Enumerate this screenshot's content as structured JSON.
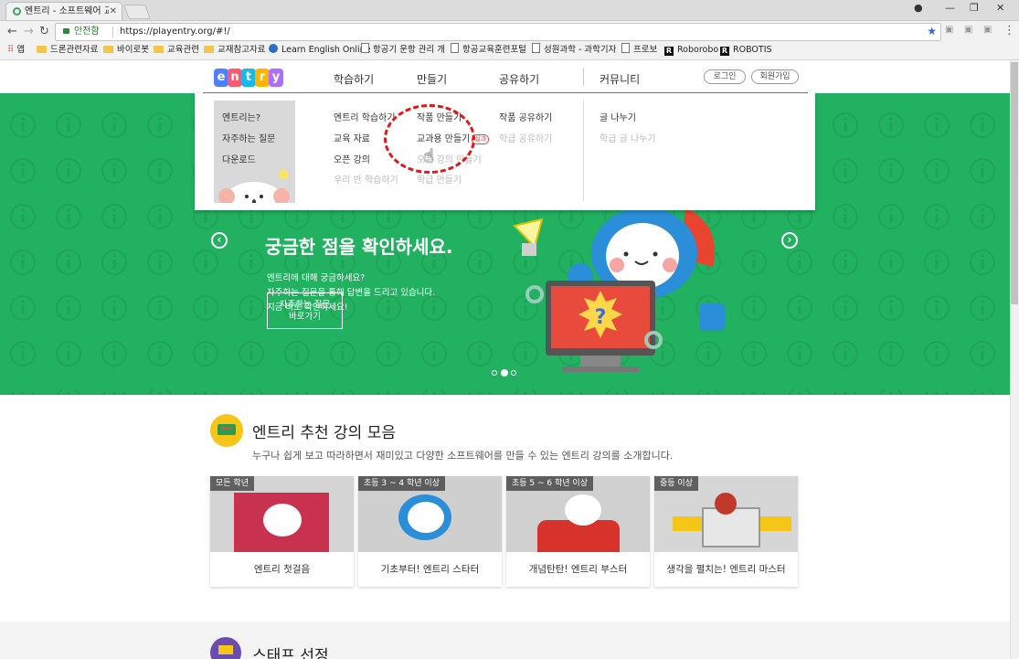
{
  "browser": {
    "tab_title": "엔트리 - 소프트웨어 교육",
    "secure_label": "안전함",
    "url": "https://playentry.org/#!/",
    "bookmarks": [
      {
        "label": "앱",
        "kind": "apps"
      },
      {
        "label": "드론관련자료",
        "kind": "folder"
      },
      {
        "label": "바이로봇",
        "kind": "folder"
      },
      {
        "label": "교육관련",
        "kind": "folder"
      },
      {
        "label": "교재참고자료",
        "kind": "folder"
      },
      {
        "label": "Learn English Online",
        "kind": "globe"
      },
      {
        "label": "항공기 운항 관리 개론",
        "kind": "doc"
      },
      {
        "label": "항공교육훈련포털",
        "kind": "doc"
      },
      {
        "label": "성원과학 - 과학기자재",
        "kind": "doc"
      },
      {
        "label": "프로보",
        "kind": "doc"
      },
      {
        "label": "Roborobo",
        "kind": "r"
      },
      {
        "label": "ROBOTIS",
        "kind": "r"
      }
    ]
  },
  "header": {
    "logo_letters": [
      "e",
      "n",
      "t",
      "r",
      "y"
    ],
    "logo_colors": [
      "#4f80ff",
      "#ff596f",
      "#19baea",
      "#ffb500",
      "#ae6eff"
    ],
    "nav": [
      "학습하기",
      "만들기",
      "공유하기",
      "커뮤니티"
    ],
    "login": "로그인",
    "signup": "회원가입"
  },
  "mega_menu": {
    "side": [
      "엔트리는?",
      "자주하는 질문",
      "다운로드"
    ],
    "learn": [
      {
        "label": "엔트리 학습하기",
        "disabled": false
      },
      {
        "label": "교육 자료",
        "disabled": false
      },
      {
        "label": "오픈 강의",
        "disabled": false
      },
      {
        "label": "우리 반 학습하기",
        "disabled": true
      }
    ],
    "make": [
      {
        "label": "작품 만들기",
        "disabled": false
      },
      {
        "label": "교과용 만들기",
        "disabled": false,
        "badge": "실과"
      },
      {
        "label": "오픈 강의 만들기",
        "disabled": true
      },
      {
        "label": "학급 만들기",
        "disabled": true
      }
    ],
    "share": [
      {
        "label": "작품 공유하기",
        "disabled": false
      },
      {
        "label": "학급 공유하기",
        "disabled": true
      }
    ],
    "community": [
      {
        "label": "글 나누기",
        "disabled": false
      },
      {
        "label": "학급 글 나누기",
        "disabled": true
      }
    ]
  },
  "hero": {
    "title": "궁금한 점을 확인하세요.",
    "lines": [
      "엔트리에 대해 궁금하세요?",
      "자주하는 질문을 통해 답변을 드리고 있습니다.",
      "지금 바로 확인하세요!"
    ],
    "button_line1": "자주하는 질문",
    "button_line2": "바로가기",
    "prev": "‹",
    "next": "›",
    "active_slide": 2,
    "slide_count": 3
  },
  "section": {
    "title": "엔트리 추천 강의 모음",
    "subtitle": "누구나 쉽게 보고 따라하면서 재미있고 다양한 소프트웨어를 만들 수 있는 엔트리 강의를 소개합니다.",
    "cards": [
      {
        "tag": "모든 학년",
        "label": "엔트리 첫걸음"
      },
      {
        "tag": "초등 3 ~ 4 학년 이상",
        "label": "기초부터! 엔트리 스타터"
      },
      {
        "tag": "초등 5 ~ 6 학년 이상",
        "label": "개념탄탄! 엔트리 부스터"
      },
      {
        "tag": "중등 이상",
        "label": "생각을 펼치는! 엔트리 마스터"
      }
    ]
  },
  "section2": {
    "title": "스태프 선정"
  }
}
